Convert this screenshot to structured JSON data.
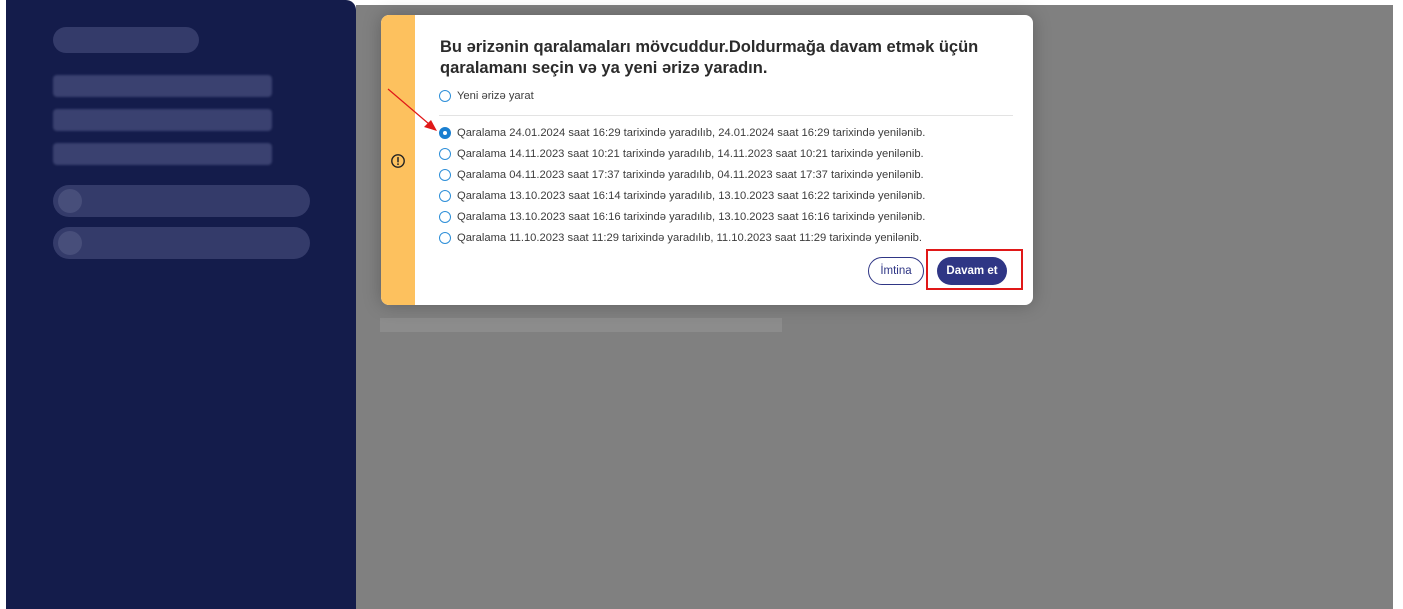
{
  "dialog": {
    "title": "Bu ərizənin qaralamaları mövcuddur.Doldurmağa davam etmək üçün qaralamanı seçin və ya yeni ərizə yaradın.",
    "new_option": "Yeni ərizə yarat",
    "drafts": [
      {
        "label": "Qaralama 24.01.2024 saat 16:29 tarixində yaradılıb, 24.01.2024 saat 16:29 tarixində yenilənib.",
        "selected": true
      },
      {
        "label": "Qaralama 14.11.2023 saat 10:21 tarixində yaradılıb, 14.11.2023 saat 10:21 tarixində yenilənib.",
        "selected": false
      },
      {
        "label": "Qaralama 04.11.2023 saat 17:37 tarixində yaradılıb, 04.11.2023 saat 17:37 tarixində yenilənib.",
        "selected": false
      },
      {
        "label": "Qaralama 13.10.2023 saat 16:14 tarixində yaradılıb, 13.10.2023 saat 16:22 tarixində yenilənib.",
        "selected": false
      },
      {
        "label": "Qaralama 13.10.2023 saat 16:16 tarixində yaradılıb, 13.10.2023 saat 16:16 tarixində yenilənib.",
        "selected": false
      },
      {
        "label": "Qaralama 11.10.2023 saat 11:29 tarixində yaradılıb, 11.10.2023 saat 11:29 tarixində yenilənib.",
        "selected": false
      }
    ],
    "cancel_label": "İmtina",
    "continue_label": "Davam et",
    "icon": "warning-circle-icon"
  },
  "colors": {
    "sidebar": "#141c4b",
    "overlay": "#808080",
    "stripe": "#fdc15e",
    "primary": "#2f3685",
    "radio": "#1a7fd0",
    "annotation": "#e01818"
  }
}
